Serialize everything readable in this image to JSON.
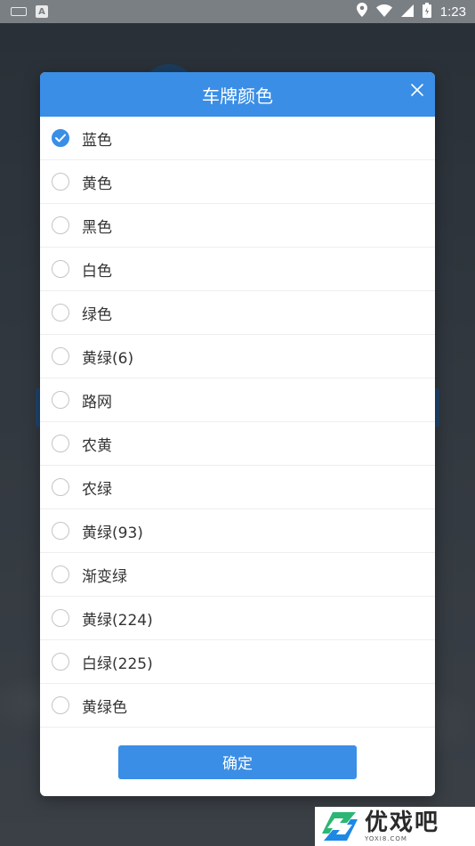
{
  "status_bar": {
    "time": "1:23",
    "icons": [
      "keyboard-icon",
      "a-icon",
      "location-icon",
      "wifi-icon",
      "signal-icon",
      "battery-icon"
    ]
  },
  "dialog": {
    "title": "车牌颜色",
    "close_icon": "close-icon",
    "options": [
      {
        "label": "蓝色",
        "checked": true
      },
      {
        "label": "黄色",
        "checked": false
      },
      {
        "label": "黑色",
        "checked": false
      },
      {
        "label": "白色",
        "checked": false
      },
      {
        "label": "绿色",
        "checked": false
      },
      {
        "label": "黄绿(6)",
        "checked": false
      },
      {
        "label": "路网",
        "checked": false
      },
      {
        "label": "农黄",
        "checked": false
      },
      {
        "label": "农绿",
        "checked": false
      },
      {
        "label": "黄绿(93)",
        "checked": false
      },
      {
        "label": "渐变绿",
        "checked": false
      },
      {
        "label": "黄绿(224)",
        "checked": false
      },
      {
        "label": "白绿(225)",
        "checked": false
      },
      {
        "label": "黄绿色",
        "checked": false
      }
    ],
    "confirm_label": "确定"
  },
  "watermark": {
    "main": "优戏吧",
    "sub": "YOXI8.COM"
  },
  "colors": {
    "accent": "#3a8ee6",
    "divider": "#eeeeee",
    "text": "#333333"
  }
}
